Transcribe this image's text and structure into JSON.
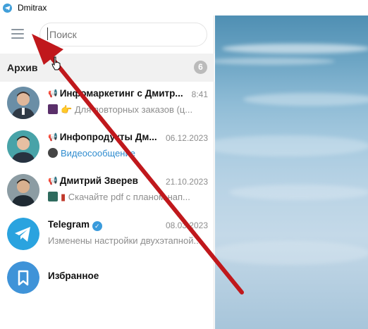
{
  "window": {
    "title": "Dmitrax"
  },
  "search": {
    "placeholder": "Поиск"
  },
  "archive": {
    "label": "Архив",
    "count": "6"
  },
  "chats": [
    {
      "name": "Инфомаркетинг с Дмитр...",
      "time": "8:41",
      "message": "Для повторных заказов (ц...",
      "type": "channel",
      "avatar": "man-portrait-1"
    },
    {
      "name": "Инфопродукты Дм...",
      "time": "06.12.2023",
      "message": "Видеосообщение",
      "type": "channel",
      "avatar": "man-portrait-2"
    },
    {
      "name": "Дмитрий Зверев",
      "time": "21.10.2023",
      "message": "Скачайте pdf с планом нап...",
      "type": "channel",
      "avatar": "man-portrait-3"
    },
    {
      "name": "Telegram",
      "time": "08.03.2023",
      "message": "Изменены настройки двухэтапной...",
      "type": "verified",
      "avatar": "telegram-logo"
    },
    {
      "name": "Избранное",
      "time": "",
      "message": "",
      "type": "saved",
      "avatar": "bookmark-icon"
    }
  ],
  "colors": {
    "accent": "#419fd9",
    "arrow": "#c0181c",
    "badge": "#bbbbbb"
  }
}
